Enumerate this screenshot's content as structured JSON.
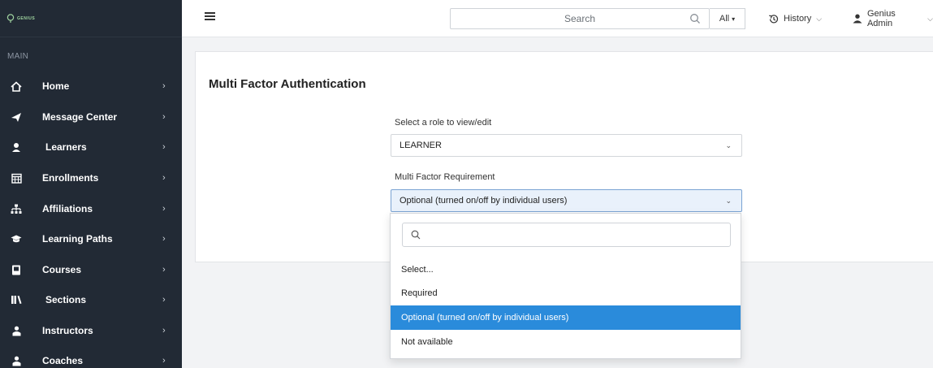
{
  "brand": {
    "name": "GENIUS"
  },
  "sidebar": {
    "section_label": "MAIN",
    "items": [
      {
        "label": "Home",
        "icon": "home-icon"
      },
      {
        "label": "Message Center",
        "icon": "send-icon"
      },
      {
        "label": "Learners",
        "icon": "learner-icon"
      },
      {
        "label": "Enrollments",
        "icon": "calendar-icon"
      },
      {
        "label": "Affiliations",
        "icon": "org-chart-icon"
      },
      {
        "label": "Learning Paths",
        "icon": "graduation-cap-icon"
      },
      {
        "label": "Courses",
        "icon": "book-icon"
      },
      {
        "label": "Sections",
        "icon": "library-icon"
      },
      {
        "label": "Instructors",
        "icon": "instructor-icon"
      },
      {
        "label": "Coaches",
        "icon": "coach-icon"
      }
    ]
  },
  "topbar": {
    "search_placeholder": "Search",
    "filter_label": "All",
    "history_label": "History",
    "user_label": "Genius Admin"
  },
  "main": {
    "title": "Multi Factor Authentication",
    "role_label": "Select a role to view/edit",
    "role_value": "LEARNER",
    "requirement_label": "Multi Factor Requirement",
    "requirement_value": "Optional (turned on/off by individual users)"
  },
  "dropdown": {
    "search_value": "",
    "options": [
      {
        "label": "Select..."
      },
      {
        "label": "Required"
      },
      {
        "label": "Optional (turned on/off by individual users)"
      },
      {
        "label": "Not available"
      }
    ],
    "selected_index": 2
  },
  "colors": {
    "sidebar_bg": "#222a35",
    "accent": "#2a8bdb",
    "brand_green": "#9fd39f"
  }
}
